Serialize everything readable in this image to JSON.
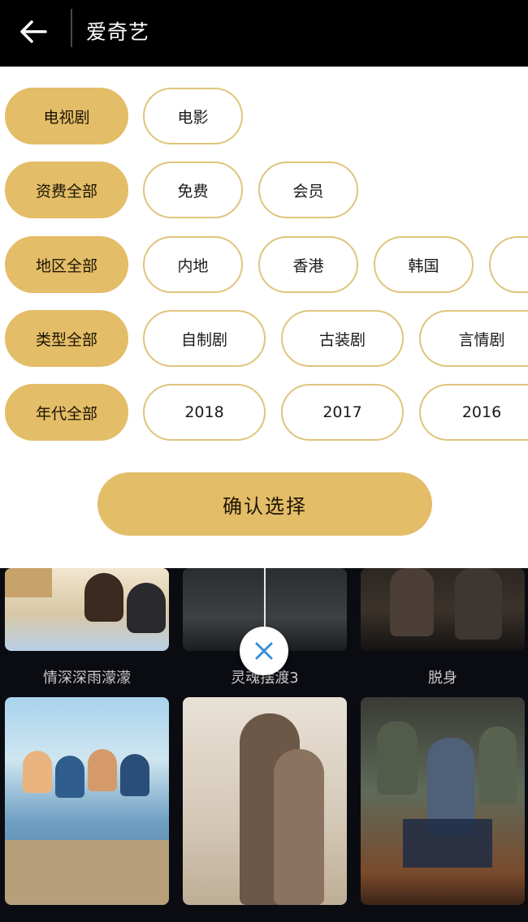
{
  "header": {
    "title": "爱奇艺"
  },
  "filters": {
    "rows": [
      {
        "label": "电视剧",
        "options": [
          "电影"
        ]
      },
      {
        "label": "资费全部",
        "options": [
          "免费",
          "会员"
        ]
      },
      {
        "label": "地区全部",
        "options": [
          "内地",
          "香港",
          "韩国"
        ]
      },
      {
        "label": "类型全部",
        "options": [
          "自制剧",
          "古装剧",
          "言情剧"
        ]
      },
      {
        "label": "年代全部",
        "options": [
          "2018",
          "2017",
          "2016"
        ]
      }
    ],
    "confirm_label": "确认选择"
  },
  "videos": {
    "row1": [
      "情深深雨濛濛",
      "灵魂摆渡3",
      "脱身"
    ]
  },
  "colors": {
    "accent": "#e3bd67",
    "chip_border": "#dfc47c",
    "header_bg": "#000000",
    "content_bg": "#0b0c12"
  },
  "icons": {
    "back": "arrow-left-icon",
    "close": "close-icon"
  }
}
